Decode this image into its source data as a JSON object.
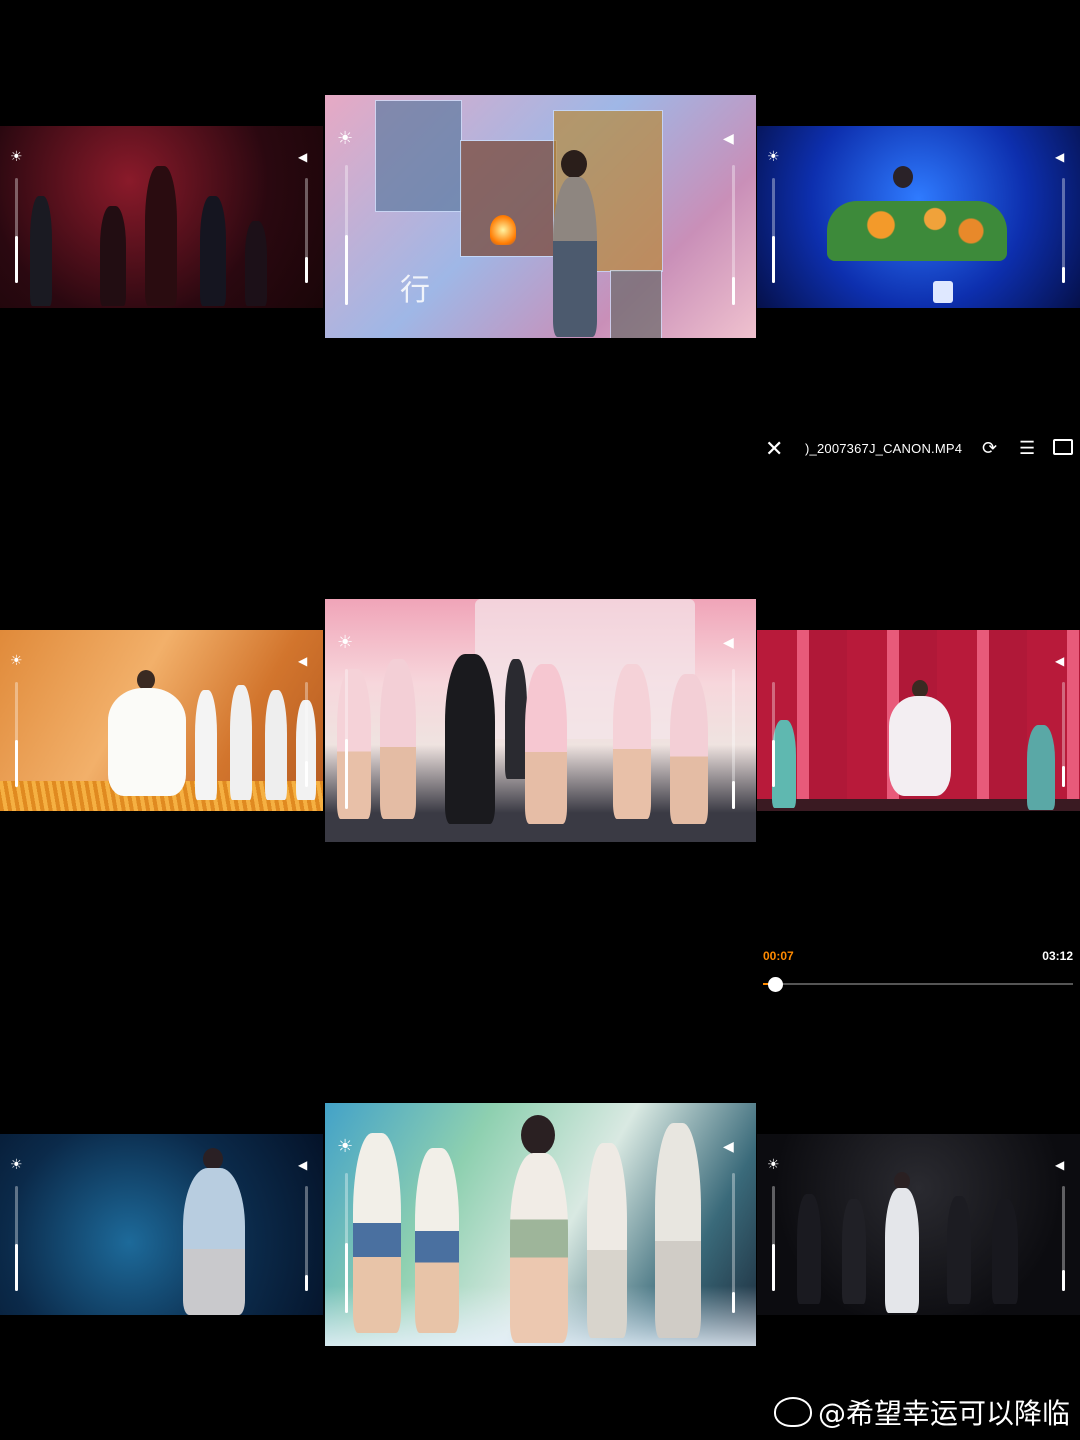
{
  "player": {
    "file_name": ")_2007367J_CANON.MP4",
    "current_time": "00:07",
    "duration": "03:12",
    "progress_fraction": 0.04,
    "accent_color": "#ff8a00"
  },
  "toolbar_icons": [
    "close-icon",
    "rotate-icon",
    "playlist-icon",
    "cast-icon"
  ],
  "tile_icons": [
    "brightness-icon",
    "volume-icon"
  ],
  "watermark": {
    "logo": "weibo-logo",
    "text": "@希望幸运可以降临"
  },
  "overlay_text": {
    "tile2_glyph": "行"
  },
  "tiles": [
    {
      "id": "r1-left",
      "brightness_level": 0.45,
      "volume_level": 0.25
    },
    {
      "id": "r1-center",
      "brightness_level": 0.5,
      "volume_level": 0.2
    },
    {
      "id": "r1-right",
      "brightness_level": 0.45,
      "volume_level": 0.15
    },
    {
      "id": "r2-left",
      "brightness_level": 0.45,
      "volume_level": 0.25
    },
    {
      "id": "r2-center",
      "brightness_level": 0.5,
      "volume_level": 0.2
    },
    {
      "id": "r2-right",
      "brightness_level": 0.45,
      "volume_level": 0.2
    },
    {
      "id": "r3-left",
      "brightness_level": 0.45,
      "volume_level": 0.15
    },
    {
      "id": "r3-center",
      "brightness_level": 0.5,
      "volume_level": 0.15
    },
    {
      "id": "r3-right",
      "brightness_level": 0.45,
      "volume_level": 0.2
    }
  ]
}
